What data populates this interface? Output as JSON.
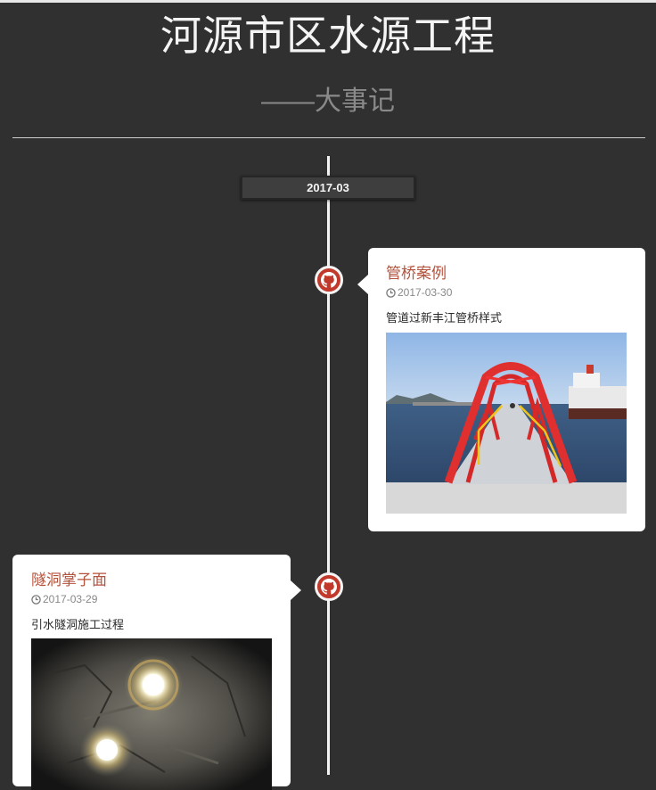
{
  "header": {
    "title": "河源市区水源工程",
    "subtitle": "——大事记"
  },
  "timeline": {
    "date_group": "2017-03",
    "events": [
      {
        "title": "管桥案例",
        "date": "2017-03-30",
        "description": "管道过新丰江管桥样式",
        "side": "right",
        "node_icon": "github-icon",
        "photo": "pipe-bridge-photo"
      },
      {
        "title": "隧洞掌子面",
        "date": "2017-03-29",
        "description": "引水隧洞施工过程",
        "side": "left",
        "node_icon": "github-icon",
        "photo": "tunnel-face-photo"
      }
    ]
  },
  "colors": {
    "background": "#303030",
    "node": "#c0392b",
    "card_title": "#b5523b",
    "card": "#ffffff"
  }
}
